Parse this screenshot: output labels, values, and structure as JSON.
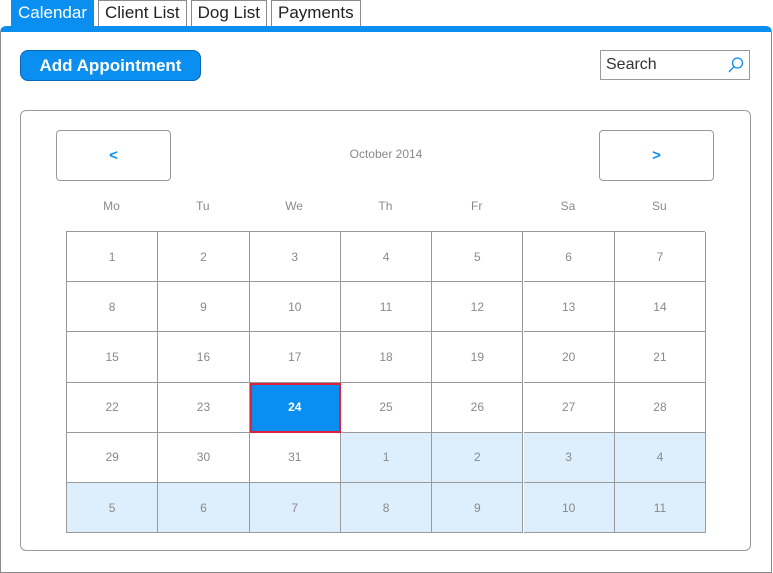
{
  "tabs": [
    {
      "label": "Calendar",
      "active": true
    },
    {
      "label": "Client List",
      "active": false
    },
    {
      "label": "Dog List",
      "active": false
    },
    {
      "label": "Payments",
      "active": false
    }
  ],
  "toolbar": {
    "add_appointment_label": "Add Appointment"
  },
  "search": {
    "placeholder": "Search",
    "icon": "search-icon"
  },
  "calendar": {
    "prev_label": "<",
    "next_label": ">",
    "month_label": "October 2014",
    "weekdays": [
      "Mo",
      "Tu",
      "We",
      "Th",
      "Fr",
      "Sa",
      "Su"
    ],
    "selected_day": "24",
    "weeks": [
      [
        {
          "d": "1",
          "other": false
        },
        {
          "d": "2",
          "other": false
        },
        {
          "d": "3",
          "other": false
        },
        {
          "d": "4",
          "other": false
        },
        {
          "d": "5",
          "other": false
        },
        {
          "d": "6",
          "other": false
        },
        {
          "d": "7",
          "other": false
        }
      ],
      [
        {
          "d": "8",
          "other": false
        },
        {
          "d": "9",
          "other": false
        },
        {
          "d": "10",
          "other": false
        },
        {
          "d": "11",
          "other": false
        },
        {
          "d": "12",
          "other": false
        },
        {
          "d": "13",
          "other": false
        },
        {
          "d": "14",
          "other": false
        }
      ],
      [
        {
          "d": "15",
          "other": false
        },
        {
          "d": "16",
          "other": false
        },
        {
          "d": "17",
          "other": false
        },
        {
          "d": "18",
          "other": false
        },
        {
          "d": "19",
          "other": false
        },
        {
          "d": "20",
          "other": false
        },
        {
          "d": "21",
          "other": false
        }
      ],
      [
        {
          "d": "22",
          "other": false
        },
        {
          "d": "23",
          "other": false
        },
        {
          "d": "24",
          "other": false
        },
        {
          "d": "25",
          "other": false
        },
        {
          "d": "26",
          "other": false
        },
        {
          "d": "27",
          "other": false
        },
        {
          "d": "28",
          "other": false
        }
      ],
      [
        {
          "d": "29",
          "other": false
        },
        {
          "d": "30",
          "other": false
        },
        {
          "d": "31",
          "other": false
        },
        {
          "d": "1",
          "other": true
        },
        {
          "d": "2",
          "other": true
        },
        {
          "d": "3",
          "other": true
        },
        {
          "d": "4",
          "other": true
        }
      ],
      [
        {
          "d": "5",
          "other": true
        },
        {
          "d": "6",
          "other": true
        },
        {
          "d": "7",
          "other": true
        },
        {
          "d": "8",
          "other": true
        },
        {
          "d": "9",
          "other": true
        },
        {
          "d": "10",
          "other": true
        },
        {
          "d": "11",
          "other": true
        }
      ]
    ]
  },
  "colors": {
    "accent": "#0a8ef0",
    "other_month": "#ddeefc",
    "selected_outline": "#e0203a"
  }
}
